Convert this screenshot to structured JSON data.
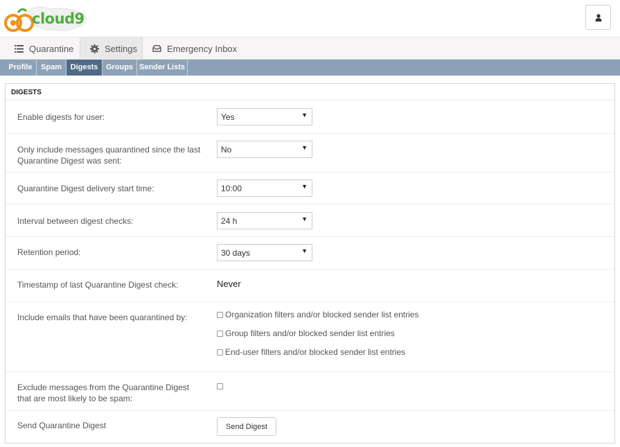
{
  "app": {
    "logo_text": "cloud9"
  },
  "tabs": [
    {
      "label": "Quarantine",
      "icon": "list-icon"
    },
    {
      "label": "Settings",
      "icon": "gear-icon"
    },
    {
      "label": "Emergency Inbox",
      "icon": "inbox-icon"
    }
  ],
  "subnav": [
    "Profile",
    "Spam",
    "Digests",
    "Groups",
    "Sender Lists"
  ],
  "panel": {
    "title": "DIGESTS",
    "enable_label": "Enable digests for user:",
    "enable_value": "Yes",
    "only_include_label": "Only include messages quarantined since the last Quarantine Digest was sent:",
    "only_include_value": "No",
    "start_time_label": "Quarantine Digest delivery start time:",
    "start_time_value": "10:00",
    "interval_label": "Interval between digest checks:",
    "interval_value": "24 h",
    "retention_label": "Retention period:",
    "retention_value": "30 days",
    "timestamp_label": "Timestamp of last Quarantine Digest check:",
    "timestamp_value": "Never",
    "include_label": "Include emails that have been quarantined by:",
    "include_options": [
      "Organization filters and/or blocked sender list entries",
      "Group filters and/or blocked sender list entries",
      "End-user filters and/or blocked sender list entries"
    ],
    "exclude_label": "Exclude messages from the Quarantine Digest that are most likely to be spam:",
    "send_label": "Send Quarantine Digest",
    "send_button": "Send Digest"
  }
}
